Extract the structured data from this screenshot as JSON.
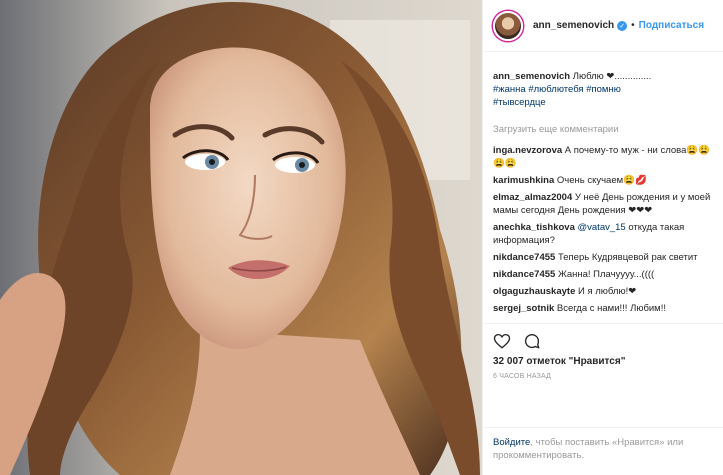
{
  "post": {
    "username": "ann_semenovich",
    "follow_label": "Подписаться",
    "dot": "•",
    "caption": {
      "user": "ann_semenovich",
      "text": " Люблю ❤.............. ",
      "tags": [
        "#жанна",
        "#люблютебя",
        "#помню",
        "#тывсердце"
      ]
    },
    "load_more": "Загрузить еще комментарии",
    "comments": [
      {
        "user": "inga.nevzorova",
        "text": " А почему-то муж - ни слова😩😩😩😩"
      },
      {
        "user": "karimushkina",
        "text": " Очень скучаем😩💋"
      },
      {
        "user": "elmaz_almaz2004",
        "text": " У неё День рождения и у моей мамы сегодня День рождения ❤❤❤"
      },
      {
        "user": "anechka_tishkova",
        "mention": "@vatav_15",
        "text": " откуда такая информация?"
      },
      {
        "user": "nikdance7455",
        "text": " Теперь Кудрявцевой рак светит"
      },
      {
        "user": "nikdance7455",
        "text": " Жанна! Плачуууу...(((("
      },
      {
        "user": "olgaguzhauskayte",
        "text": " И я люблю!❤"
      },
      {
        "user": "sergej_sotnik",
        "text": " Всегда с нами!!! Любим!!"
      }
    ],
    "likes": "32 007 отметок \"Нравится\"",
    "time": "6 ЧАСОВ НАЗАД",
    "login": {
      "link": "Войдите",
      "text": ", чтобы поставить «Нравится» или прокомментировать."
    },
    "icons": [
      "heart-icon",
      "comment-icon",
      "verified-icon"
    ],
    "colors": {
      "accent": "#3897f0",
      "tag": "#003569",
      "muted": "#999999"
    }
  }
}
